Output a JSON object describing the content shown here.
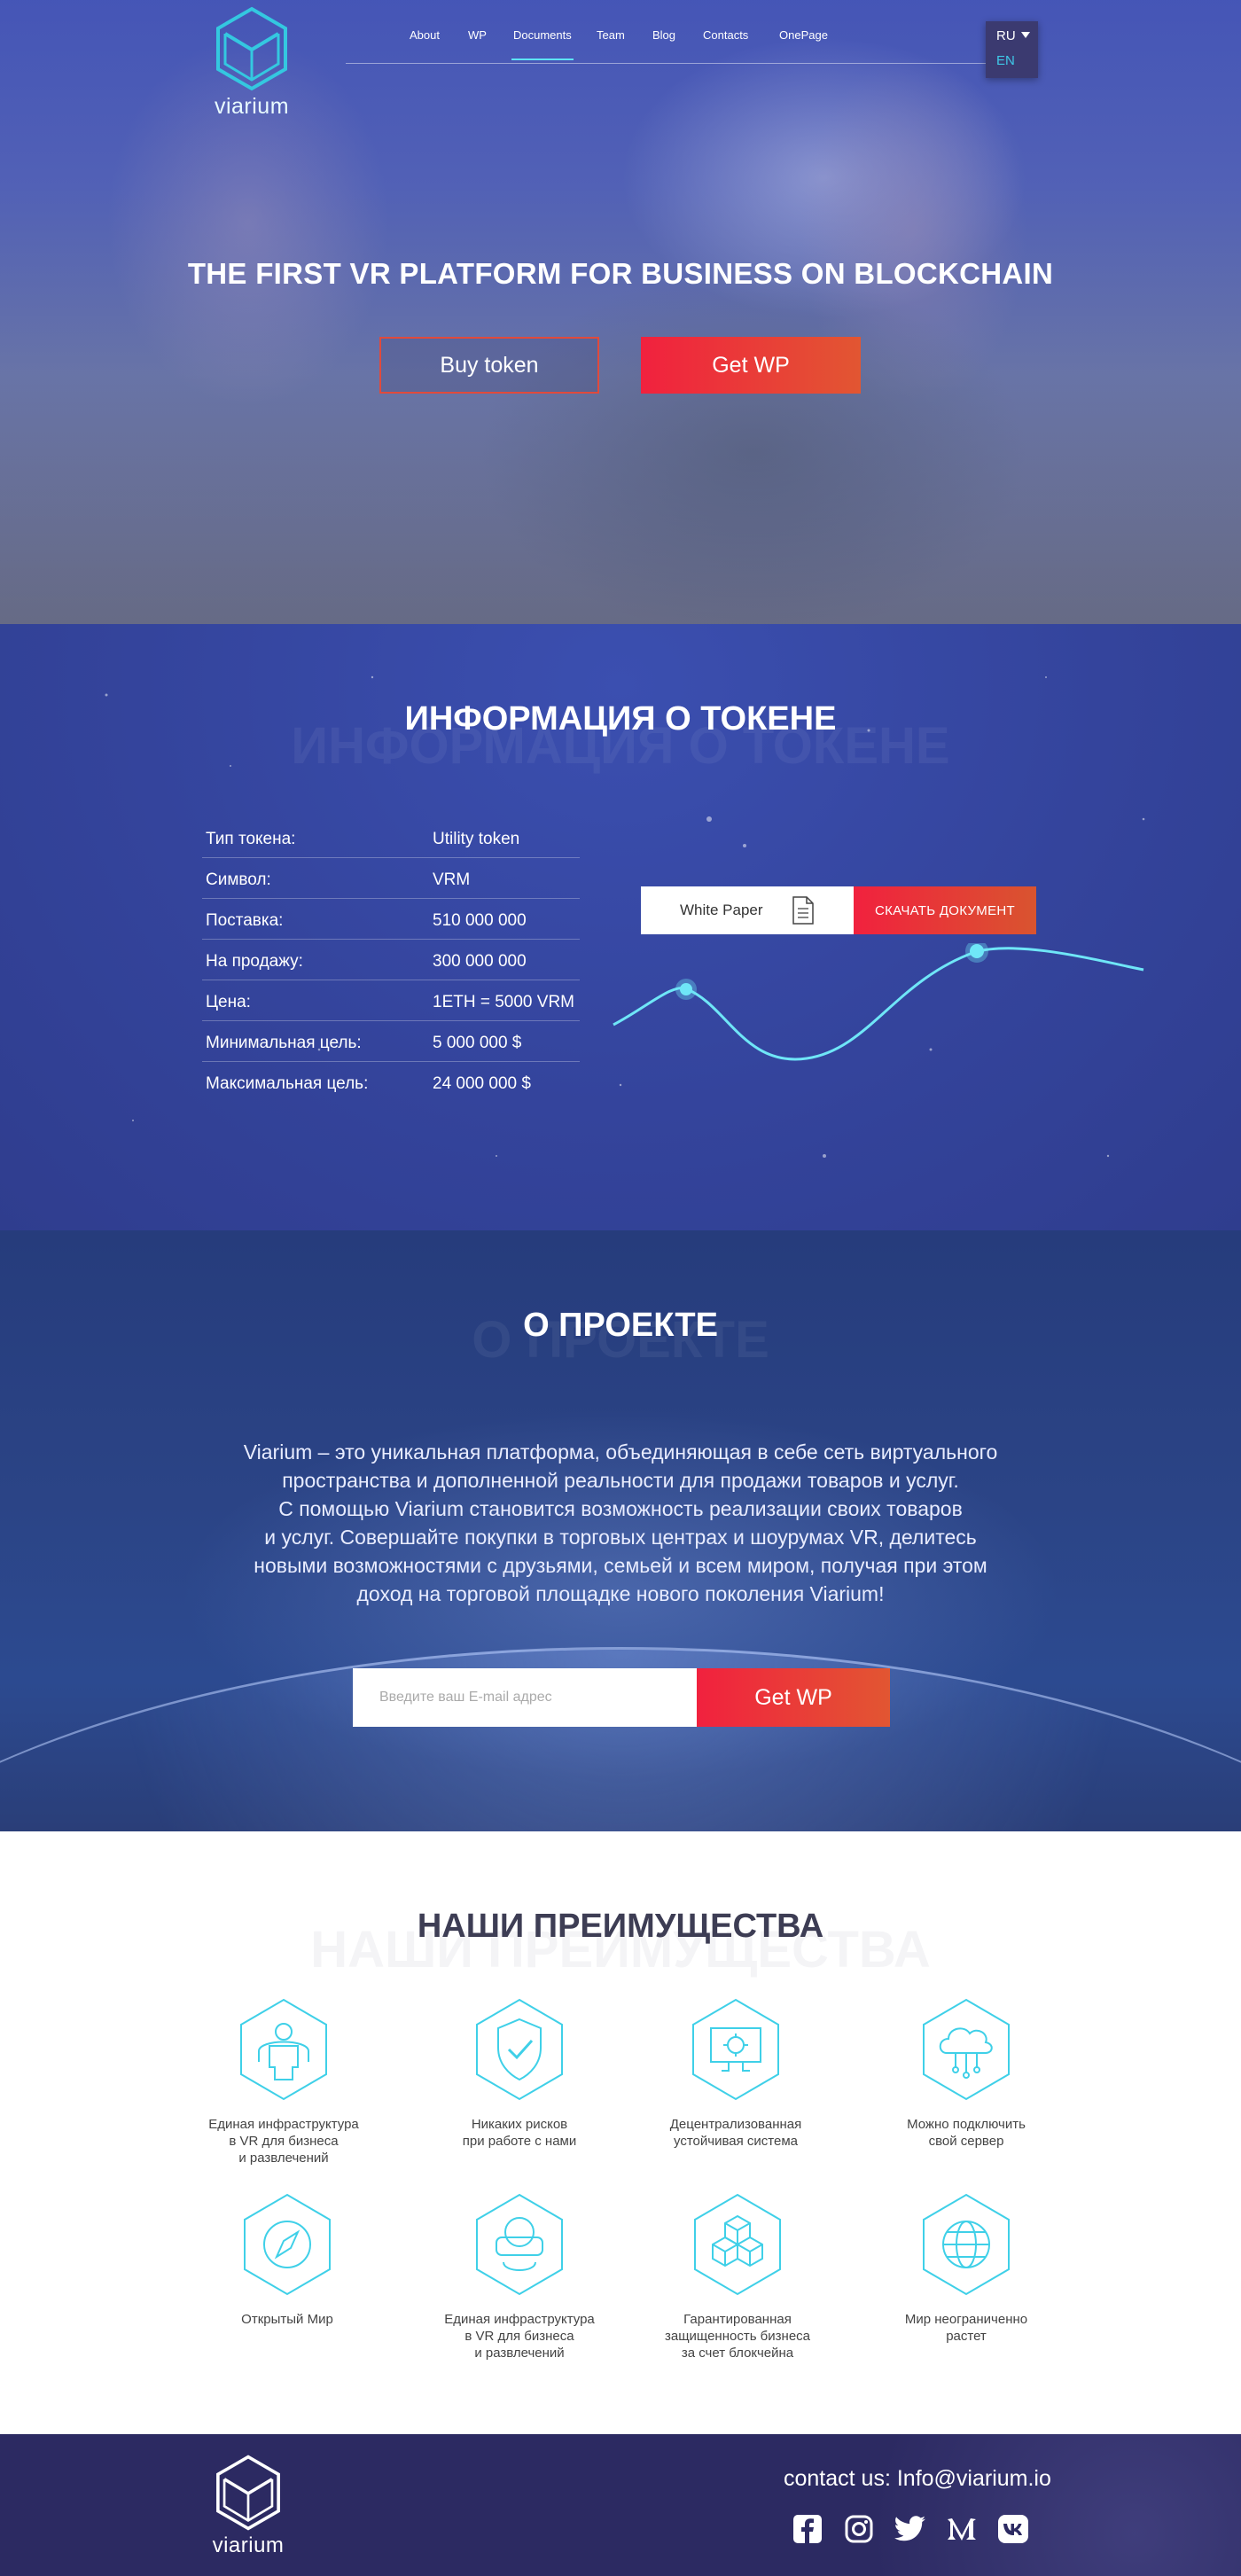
{
  "brand": {
    "name": "viarium"
  },
  "nav": {
    "items": [
      "About",
      "WP",
      "Documents",
      "Team",
      "Blog",
      "Contacts",
      "OnePage"
    ],
    "active": "Documents"
  },
  "lang": {
    "current": "RU",
    "alternative": "EN"
  },
  "hero": {
    "title": "THE FIRST VR PLATFORM FOR BUSINESS ON BLOCKCHAIN",
    "buy_label": "Buy token",
    "wp_label": "Get WP"
  },
  "token": {
    "title": "ИНФОРМАЦИЯ О ТОКЕНЕ",
    "ghost": "ИНФОРМАЦИЯ О ТОКЕНЕ",
    "rows": [
      {
        "key": "Тип токена:",
        "value": "Utility token"
      },
      {
        "key": "Символ:",
        "value": "VRM"
      },
      {
        "key": "Поставка:",
        "value": "510 000 000"
      },
      {
        "key": "На продажу:",
        "value": "300 000 000"
      },
      {
        "key": "Цена:",
        "value": "1ETH = 5000 VRM"
      },
      {
        "key": "Минимальная цель:",
        "value": "5 000 000 $"
      },
      {
        "key": "Максимальная цель:",
        "value": "24 000 000 $"
      }
    ],
    "white_paper_label": "White Paper",
    "download_label": "СКАЧАТЬ ДОКУМЕНТ"
  },
  "about": {
    "title": "О ПРОЕКТЕ",
    "ghost": "О ПРОЕКТЕ",
    "text_lines": [
      "Viarium – это уникальная платформа, объединяющая в себе сеть виртуального",
      "пространства и дополненной реальности для продажи товаров и услуг.",
      "С помощью Viarium становится возможность реализации своих товаров",
      "и услуг. Совершайте покупки в торговых центрах и шоурумах VR, делитесь",
      "новыми возможностями с друзьями, семьей и всем миром, получая при этом",
      "доход на торговой площадке нового поколения Viarium!"
    ],
    "email_placeholder": "Введите ваш E-mail адрес",
    "button_label": "Get WP"
  },
  "advantages": {
    "title": "НАШИ ПРЕИМУЩЕСТВА",
    "ghost": "НАШИ ПРЕИМУЩЕСТВА",
    "items": [
      {
        "icon": "vr-person-icon",
        "lines": [
          "Единая инфраструктура",
          "в VR для бизнеса",
          "и развлечений"
        ]
      },
      {
        "icon": "shield-check-icon",
        "lines": [
          "Никаких рисков",
          "при работе с нами"
        ]
      },
      {
        "icon": "monitor-chip-icon",
        "lines": [
          "Децентрализованная",
          "устойчивая система"
        ]
      },
      {
        "icon": "cloud-server-icon",
        "lines": [
          "Можно подключить",
          "свой сервер"
        ]
      },
      {
        "icon": "compass-icon",
        "lines": [
          "Открытый Мир"
        ]
      },
      {
        "icon": "vr-headset-icon",
        "lines": [
          "Единая инфраструктура",
          "в VR для бизнеса",
          "и развлечений"
        ]
      },
      {
        "icon": "blocks-icon",
        "lines": [
          "Гарантированная",
          "защищенность бизнеса",
          "за счет блокчейна"
        ]
      },
      {
        "icon": "globe-icon",
        "lines": [
          "Мир неограниченно",
          "растет"
        ]
      }
    ]
  },
  "footer": {
    "contact_label": "contact us: Info@viarium.io",
    "socials": [
      "facebook-icon",
      "instagram-icon",
      "twitter-icon",
      "medium-icon",
      "vk-icon"
    ]
  },
  "colors": {
    "accent_cyan": "#3fc9e8",
    "cta_start": "#f1213e",
    "cta_end": "#e25632",
    "hero_blue": "#4a5bb8",
    "footer_bg": "#2c2a62"
  }
}
